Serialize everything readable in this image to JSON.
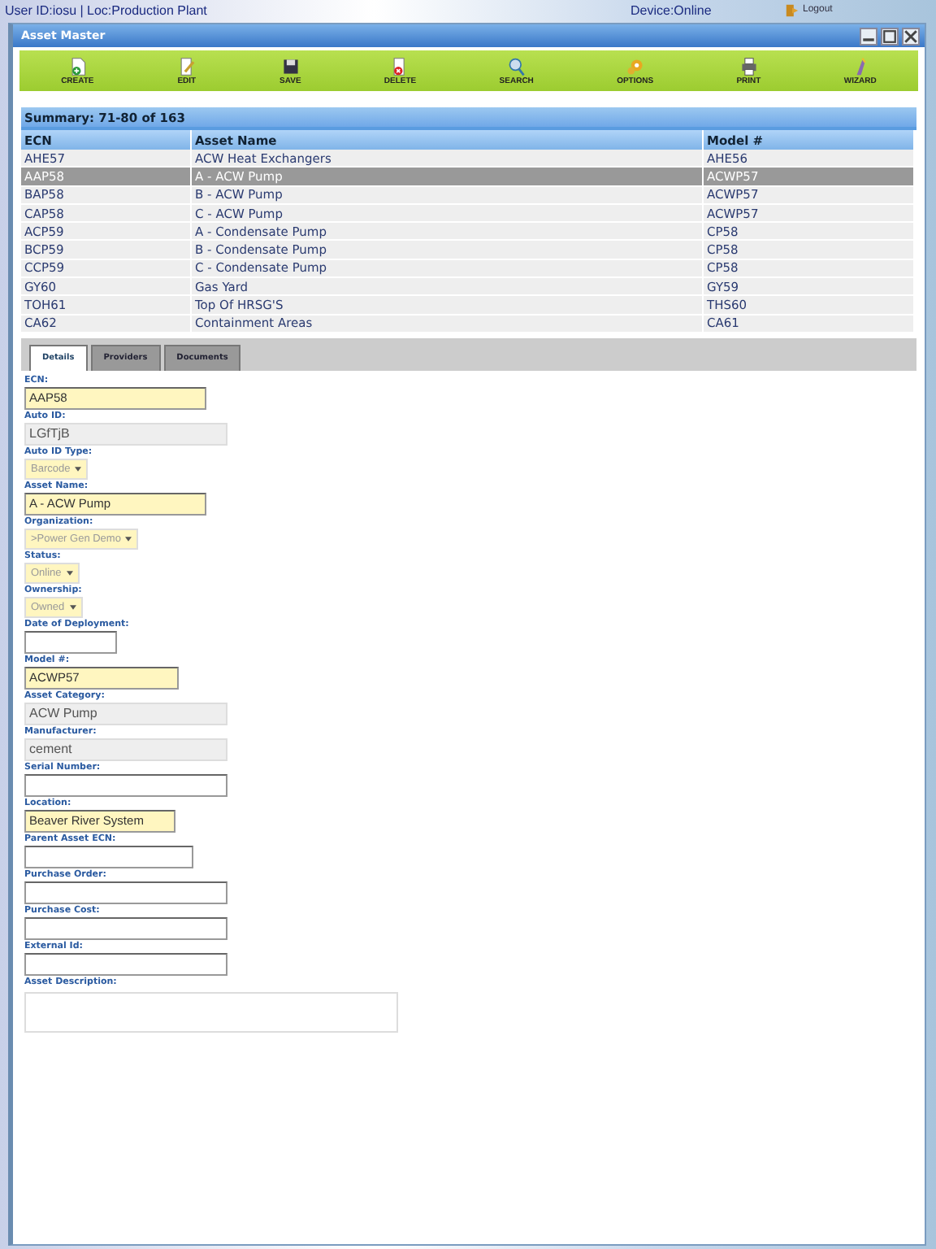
{
  "top_bar": {
    "user": "User ID:iosu | Loc:Production Plant",
    "device": "Device:Online",
    "logout": "Logout"
  },
  "window": {
    "title": "Asset Master"
  },
  "toolbar": [
    {
      "kind": "create",
      "label": "CREATE"
    },
    {
      "kind": "edit",
      "label": "EDIT"
    },
    {
      "kind": "save",
      "label": "SAVE"
    },
    {
      "kind": "delete",
      "label": "DELETE"
    },
    {
      "kind": "search",
      "label": "SEARCH"
    },
    {
      "kind": "options",
      "label": "OPTIONS"
    },
    {
      "kind": "print",
      "label": "PRINT"
    },
    {
      "kind": "wizard",
      "label": "WIZARD"
    }
  ],
  "summary": "Summary: 71-80 of 163",
  "table": {
    "columns": [
      "ECN",
      "Asset Name",
      "Model #"
    ],
    "rows": [
      {
        "cells": [
          "AHE57",
          "ACW Heat Exchangers",
          "AHE56"
        ],
        "selected": false
      },
      {
        "cells": [
          "AAP58",
          "A - ACW Pump",
          "ACWP57"
        ],
        "selected": true
      },
      {
        "cells": [
          "BAP58",
          "B - ACW Pump",
          "ACWP57"
        ],
        "selected": false
      },
      {
        "cells": [
          "CAP58",
          "C - ACW Pump",
          "ACWP57"
        ],
        "selected": false
      },
      {
        "cells": [
          "ACP59",
          "A - Condensate Pump",
          "CP58"
        ],
        "selected": false
      },
      {
        "cells": [
          "BCP59",
          "B - Condensate Pump",
          "CP58"
        ],
        "selected": false
      },
      {
        "cells": [
          "CCP59",
          "C - Condensate Pump",
          "CP58"
        ],
        "selected": false
      },
      {
        "cells": [
          "GY60",
          "Gas Yard",
          "GY59"
        ],
        "selected": false
      },
      {
        "cells": [
          "TOH61",
          "Top Of HRSG'S",
          "THS60"
        ],
        "selected": false
      },
      {
        "cells": [
          "CA62",
          "Containment Areas",
          "CA61"
        ],
        "selected": false
      }
    ]
  },
  "tabs": [
    {
      "label": "Details",
      "selected": true
    },
    {
      "label": "Providers",
      "selected": false
    },
    {
      "label": "Documents",
      "selected": false
    }
  ],
  "fields": [
    {
      "label": "ECN:",
      "kind": "required",
      "value": "AAP58"
    },
    {
      "label": "Auto ID:",
      "kind": "readonly",
      "value": "LGfTjB"
    },
    {
      "label": "Auto ID Type:",
      "kind": "select",
      "value": "Barcode"
    },
    {
      "label": "Asset Name:",
      "kind": "required",
      "value": "A - ACW Pump"
    },
    {
      "label": "Organization:",
      "kind": "select",
      "value": ">Power Gen Demo"
    },
    {
      "label": "Status:",
      "kind": "select",
      "value": "Online"
    },
    {
      "label": "Ownership:",
      "kind": "select",
      "value": "Owned"
    },
    {
      "label": "Date of Deployment:",
      "kind": "text"
    },
    {
      "label": "Model #:",
      "kind": "required",
      "value": "ACWP57"
    },
    {
      "label": "Asset Category:",
      "kind": "readonly",
      "value": "ACW Pump"
    },
    {
      "label": "Manufacturer:",
      "kind": "readonly",
      "value": "cement"
    },
    {
      "label": "Serial Number:",
      "kind": "text"
    },
    {
      "label": "Location:",
      "kind": "required",
      "value": "Beaver River System"
    },
    {
      "label": "Parent Asset ECN:",
      "kind": "text"
    },
    {
      "label": "Purchase Order:",
      "kind": "text"
    },
    {
      "label": "Purchase Cost:",
      "kind": "text"
    },
    {
      "label": "External Id:",
      "kind": "text"
    },
    {
      "label": "Asset Description:",
      "kind": "textarea"
    }
  ]
}
